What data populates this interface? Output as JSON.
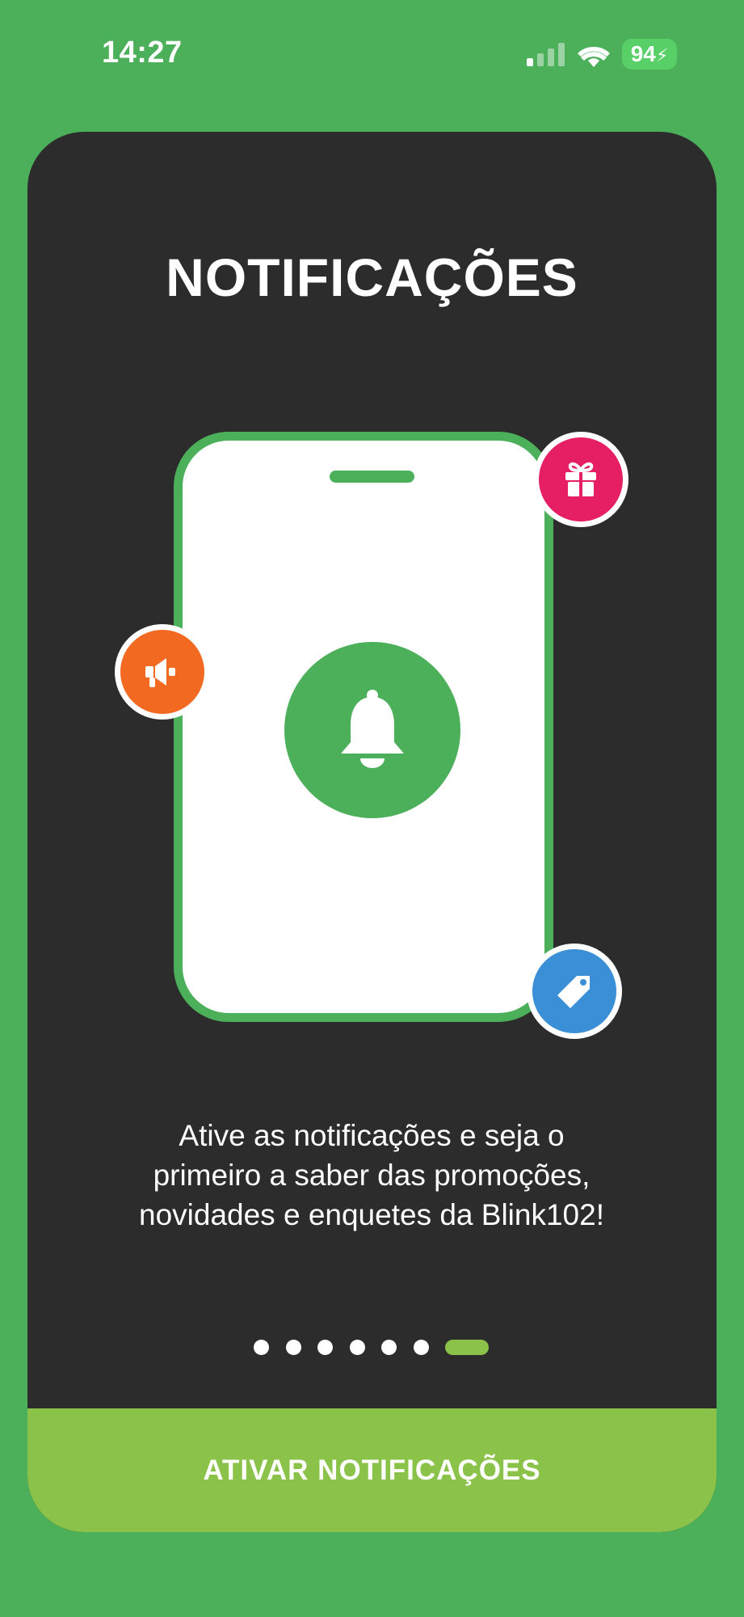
{
  "status_bar": {
    "time": "14:27",
    "battery": "94"
  },
  "onboarding": {
    "title": "NOTIFICAÇÕES",
    "description_lines": [
      "Ative as notificações e seja o",
      "primeiro a saber das promoções,",
      "novidades e enquetes da Blink102!"
    ],
    "page_count": 7,
    "current_page": 7,
    "cta_label": "ATIVAR NOTIFICAÇÕES"
  },
  "illustration": {
    "icons": [
      "bell-icon",
      "gift-icon",
      "megaphone-icon",
      "tag-icon"
    ]
  },
  "colors": {
    "background_green": "#4caf5a",
    "card_dark": "#2c2c2c",
    "cta_lime": "#8bc34a",
    "gift_pink": "#e61f64",
    "megaphone_orange": "#f26a22",
    "tag_blue": "#3a8fd6"
  }
}
